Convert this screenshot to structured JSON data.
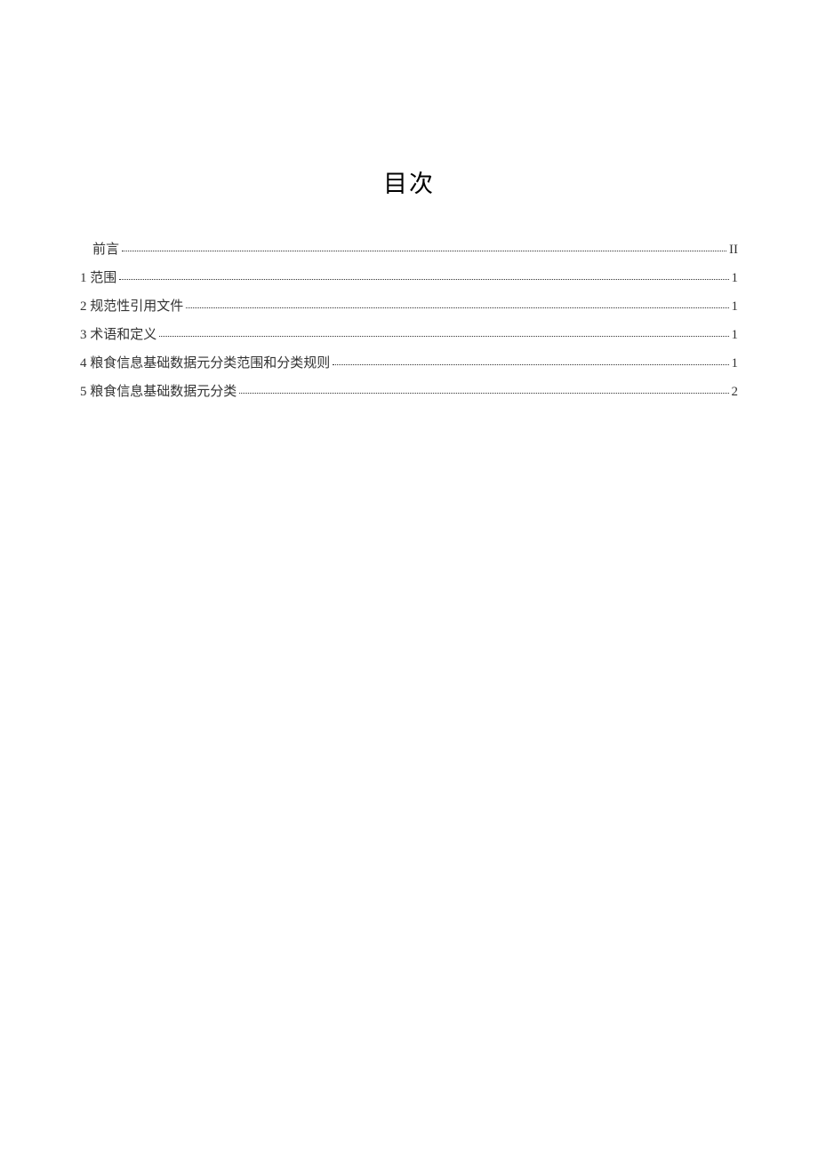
{
  "title": "目次",
  "entries": [
    {
      "label": "前言",
      "page": "II",
      "indent": true
    },
    {
      "label": "1 范围",
      "page": "1",
      "indent": false
    },
    {
      "label": "2 规范性引用文件",
      "page": "1",
      "indent": false
    },
    {
      "label": "3 术语和定义",
      "page": "1",
      "indent": false
    },
    {
      "label": "4 粮食信息基础数据元分类范围和分类规则",
      "page": "1",
      "indent": false
    },
    {
      "label": "5 粮食信息基础数据元分类",
      "page": "2",
      "indent": false
    }
  ]
}
